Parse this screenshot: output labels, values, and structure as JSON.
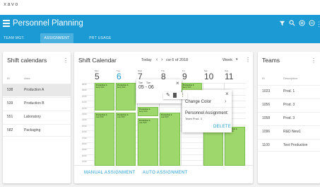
{
  "brand": "xavo",
  "app": {
    "title": "Personnel Planning"
  },
  "tabs": [
    {
      "label": "TEAM MGT."
    },
    {
      "label": "ASSIGNMENT"
    },
    {
      "label": "PRT USAGE"
    }
  ],
  "shift_calendars": {
    "title": "Shift calendars",
    "columns": [
      "ID",
      "Area"
    ],
    "rows": [
      {
        "id": "538",
        "area": "Production A"
      },
      {
        "id": "539",
        "area": "Production B"
      },
      {
        "id": "551",
        "area": "Laboratory"
      },
      {
        "id": "582",
        "area": "Packaging"
      }
    ]
  },
  "calendar": {
    "title": "Shift Calendar",
    "today_label": "Today",
    "range_label": "cw 6 of 2018",
    "view_label": "Week",
    "days": [
      {
        "name": "Mon",
        "num": "5"
      },
      {
        "name": "Tue",
        "num": "6"
      },
      {
        "name": "Wed",
        "num": "7"
      },
      {
        "name": "Thu",
        "num": "8"
      },
      {
        "name": "Fri",
        "num": "9"
      },
      {
        "name": "Sat",
        "num": "10"
      },
      {
        "name": "Sun",
        "num": "11"
      }
    ],
    "times": [
      "08:00",
      "09:00",
      "10:00",
      "11:00",
      "12:00",
      "13:00",
      "14:00",
      "15:00",
      "16:00",
      "17:00",
      "18:00",
      "19:00",
      "20:00",
      "21:00"
    ],
    "events": [
      {
        "title": "Production A",
        "sub": "Early Shift"
      },
      {
        "title": "Production A",
        "sub": "Early Shift"
      },
      {
        "title": "Production A",
        "sub": "Early Shift"
      },
      {
        "title": "Production A",
        "sub": "Early Shift"
      },
      {
        "title": "Production A",
        "sub": "Early Shift"
      },
      {
        "title": "Production A",
        "sub": "Late Shift"
      },
      {
        "title": "Production A",
        "sub": "Late Shift"
      },
      {
        "title": "Production A",
        "sub": "Late Shift"
      },
      {
        "title": "Production A",
        "sub": "Late Shift"
      },
      {
        "title": "Production A",
        "sub": "Late Shift"
      },
      {
        "title": "Production A",
        "sub": "Late Shift"
      }
    ],
    "detail_popup": {
      "line1": "Tue",
      "line2": "Tue",
      "range": "05 - 06"
    },
    "menu_popup": {
      "change_color": "Change Color",
      "assignment_label": "Personnel Assignment:",
      "assignment_value": "Team Prod. 3",
      "delete_label": "DELETE"
    },
    "manual_button": "MANUAL ASSIGNMENT",
    "auto_button": "AUTO ASSIGNMENT"
  },
  "teams": {
    "title": "Teams",
    "columns": [
      "ID",
      "Description"
    ],
    "rows": [
      {
        "id": "1023",
        "desc": "Prod. 1"
      },
      {
        "id": "1056",
        "desc": "Prod. 3"
      },
      {
        "id": "1058",
        "desc": "Prod. 3"
      },
      {
        "id": "1096",
        "desc": "R&D New1"
      },
      {
        "id": "1100",
        "desc": "Test Production"
      }
    ]
  }
}
